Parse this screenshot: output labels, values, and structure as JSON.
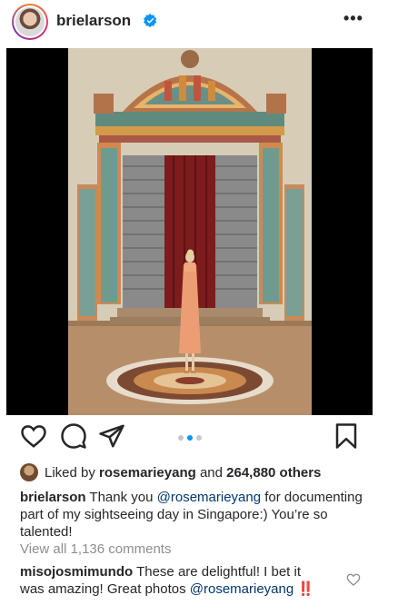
{
  "header": {
    "username": "brielarson",
    "more_label": "•••"
  },
  "post": {
    "image_icon": "photo-scene-temple-door",
    "carousel_count": 3,
    "carousel_active": 2
  },
  "actions": {
    "like_icon": "heart-icon",
    "comment_icon": "comment-icon",
    "share_icon": "paper-plane-icon",
    "save_icon": "bookmark-icon"
  },
  "likes": {
    "prefix": "Liked by ",
    "user": "rosemarieyang",
    "middle": " and ",
    "count": "264,880 others"
  },
  "caption": {
    "user": "brielarson",
    "text_1": " Thank you ",
    "mention": "@rosemarieyang",
    "text_2": " for documenting part of my sightseeing day in Singapore:) You’re so talented!"
  },
  "view_comments": "View all 1,136 comments",
  "comment": {
    "user": "misojosmimundo",
    "text": " These are delightful! I bet it was amazing! Great photos ",
    "mention": "@rosemarieyang",
    "emoji": " ‼️"
  },
  "colors": {
    "link": "#00376b",
    "accent": "#0095f6",
    "verified": "#0095f6",
    "muted": "#8e8e8e"
  }
}
